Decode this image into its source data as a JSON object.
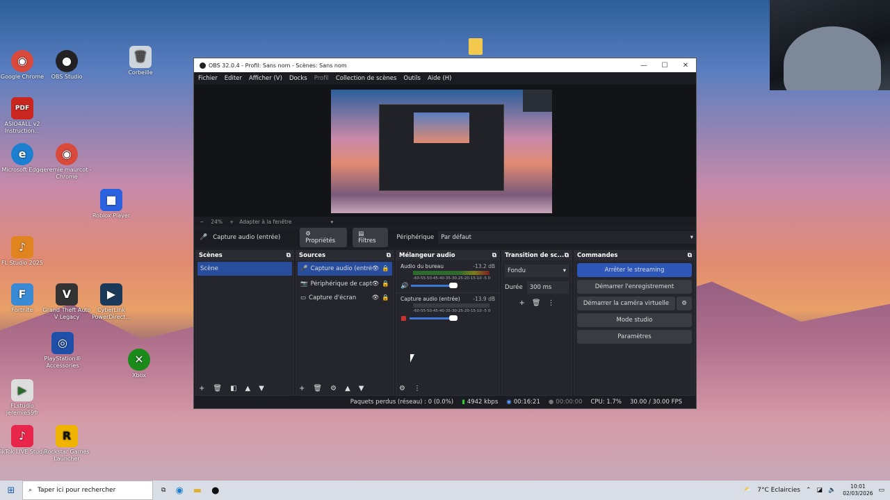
{
  "desktop": {
    "icons": [
      {
        "label": "Google Chrome",
        "glyph": "◉",
        "color": "#d94a3d"
      },
      {
        "label": "OBS Studio",
        "glyph": "●",
        "color": "#222"
      },
      {
        "label": "Corbeille",
        "glyph": "🗑",
        "color": "#aaa"
      },
      {
        "label": "ASIO4ALL v2 Instruction...",
        "glyph": "PDF",
        "color": "#c8261f"
      },
      {
        "label": "Microsoft Edge",
        "glyph": "e",
        "color": "#1d7fd0"
      },
      {
        "label": "jeremie maurcot - Chrome",
        "glyph": "◉",
        "color": "#d94a3d"
      },
      {
        "label": "Roblox Player",
        "glyph": "■",
        "color": "#2a62e0"
      },
      {
        "label": "FL Studio 2025",
        "glyph": "♪",
        "color": "#e08420"
      },
      {
        "label": "Fortnite",
        "glyph": "F",
        "color": "#3a8ad6"
      },
      {
        "label": "Grand Theft Auto V Legacy",
        "glyph": "V",
        "color": "#333"
      },
      {
        "label": "CyberLink PowerDirect...",
        "glyph": "▶",
        "color": "#1b3a5a"
      },
      {
        "label": "PlayStation® Accessories",
        "glyph": "◎",
        "color": "#1f4fa8"
      },
      {
        "label": "Xbox",
        "glyph": "✕",
        "color": "#1a8a1a"
      },
      {
        "label": "FLstudio jeremie59fr",
        "glyph": "▶",
        "color": "#ddd"
      },
      {
        "label": "TikTok LIVE Studio",
        "glyph": "♪",
        "color": "#e8254a"
      },
      {
        "label": "Rockstar Games Launcher",
        "glyph": "R",
        "color": "#f0b400"
      }
    ]
  },
  "window": {
    "title": "OBS 32.0.4 - Profil: Sans nom - Scènes: Sans nom",
    "minimize": "—",
    "maximize": "☐",
    "close": "✕",
    "menu": [
      "Fichier",
      "Editer",
      "Afficher (V)",
      "Docks",
      "Profil",
      "Collection de scènes",
      "Outils",
      "Aide (H)"
    ]
  },
  "zoom": {
    "minus": "−",
    "value": "24%",
    "plus": "+",
    "fit": "Adapter à la fenêtre"
  },
  "source_toolbar": {
    "source": "Capture audio (entrée)",
    "properties": "Propriétés",
    "filters": "Filtres",
    "device_label": "Périphérique",
    "device_value": "Par défaut"
  },
  "scenes": {
    "title": "Scènes",
    "items": [
      "Scène"
    ]
  },
  "sources": {
    "title": "Sources",
    "items": [
      "Capture audio (entré",
      "Périphérique de capt",
      "Capture d'écran"
    ]
  },
  "mixer": {
    "title": "Mélangeur audio",
    "channels": [
      {
        "name": "Audio du bureau",
        "db": "-13.2 dB",
        "scale": "-60-55-50-45-40-35-30-25-20-15-10 -5 0"
      },
      {
        "name": "Capture audio (entrée)",
        "db": "-13.9 dB",
        "scale": "-60-55-50-45-40-35-30-25-20-15-10 -5 0"
      }
    ]
  },
  "transition": {
    "title": "Transition de sc...",
    "type": "Fondu",
    "duration_label": "Durée",
    "duration_value": "300 ms"
  },
  "commands": {
    "title": "Commandes",
    "buttons": [
      "Arrêter le streaming",
      "Démarrer l'enregistrement",
      "Démarrer la caméra virtuelle",
      "Mode studio",
      "Paramètres"
    ]
  },
  "status": {
    "dropped": "Paquets perdus (réseau) : 0 (0.0%)",
    "bitrate": "4942 kbps",
    "stream_time": "00:16:21",
    "rec_time": "00:00:00",
    "cpu": "CPU: 1.7%",
    "fps": "30.00 / 30.00 FPS"
  },
  "taskbar": {
    "search_placeholder": "Taper ici pour rechercher",
    "weather": "7°C  Eclaircies",
    "time": "10:01",
    "date": "02/03/2026"
  }
}
